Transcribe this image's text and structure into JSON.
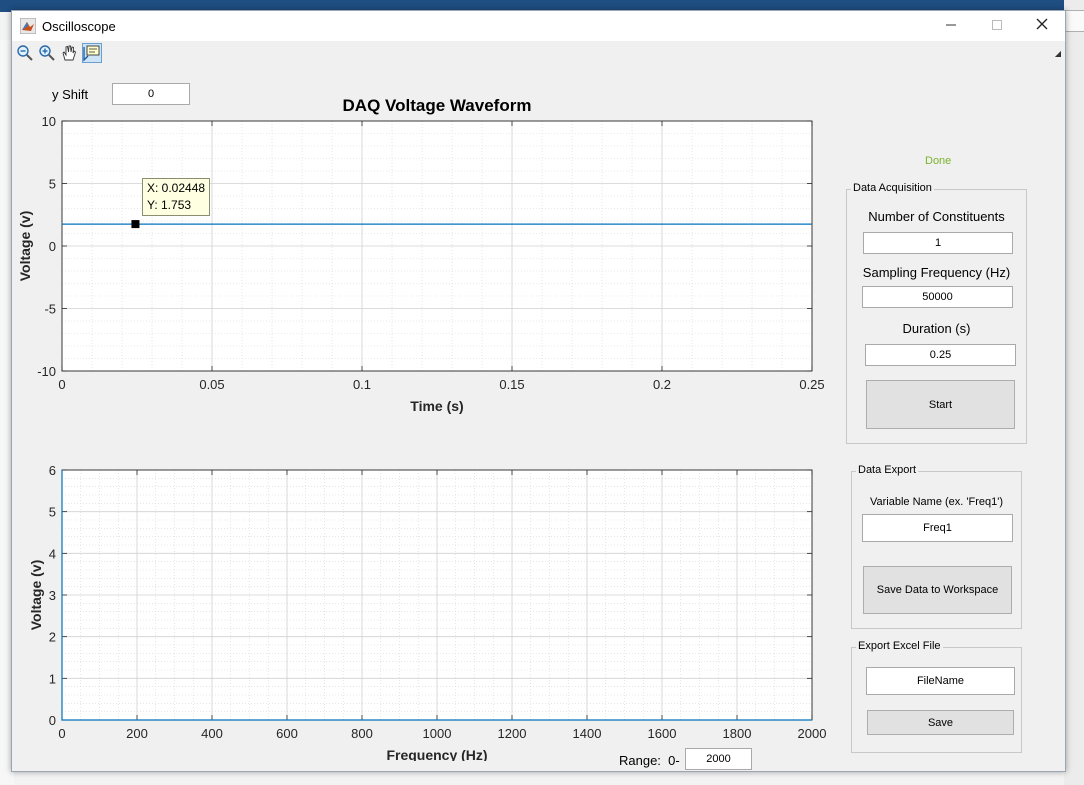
{
  "window": {
    "title": "Oscilloscope"
  },
  "toolbar": {
    "tools": [
      "zoom-out-icon",
      "zoom-in-icon",
      "pan-hand-icon",
      "data-cursor-icon"
    ]
  },
  "y_shift": {
    "label": "y Shift",
    "value": "0"
  },
  "status": {
    "text": "Done",
    "color": "#7ab32e"
  },
  "acquisition": {
    "title": "Data Acquisition",
    "constituents_label": "Number of Constituents",
    "constituents_value": "1",
    "sampling_label": "Sampling Frequency (Hz)",
    "sampling_value": "50000",
    "duration_label": "Duration (s)",
    "duration_value": "0.25",
    "start_label": "Start"
  },
  "export": {
    "title": "Data Export",
    "var_label": "Variable Name (ex. 'Freq1')",
    "var_value": "Freq1",
    "save_ws_label": "Save Data to Workspace"
  },
  "excel": {
    "title": "Export Excel File",
    "filename_value": "FileName",
    "save_label": "Save"
  },
  "range": {
    "label": "Range:  0-",
    "value": "2000"
  },
  "chart_data": [
    {
      "type": "line",
      "title": "DAQ Voltage Waveform",
      "xlabel": "Time (s)",
      "ylabel": "Voltage (v)",
      "xlim": [
        0,
        0.25
      ],
      "ylim": [
        -10,
        10
      ],
      "xticks": [
        0,
        0.05,
        0.1,
        0.15,
        0.2,
        0.25
      ],
      "xtick_labels": [
        "0",
        "0.05",
        "0.1",
        "0.15",
        "0.2",
        "0.25"
      ],
      "yticks": [
        -10,
        -5,
        0,
        5,
        10
      ],
      "ytick_labels": [
        "-10",
        "-5",
        "0",
        "5",
        "10"
      ],
      "grid": true,
      "minor_grid": true,
      "series": [
        {
          "x": [
            0,
            0.25
          ],
          "y": [
            1.753,
            1.753
          ],
          "color": "#0072bd"
        }
      ],
      "datatip": {
        "x": 0.02448,
        "y": 1.753,
        "xtext": "X: 0.02448",
        "ytext": "Y: 1.753"
      }
    },
    {
      "type": "line",
      "title": "",
      "xlabel": "Frequency (Hz)",
      "ylabel": "Voltage (v)",
      "xlim": [
        0,
        2000
      ],
      "ylim": [
        0,
        6
      ],
      "xticks": [
        0,
        200,
        400,
        600,
        800,
        1000,
        1200,
        1400,
        1600,
        1800,
        2000
      ],
      "xtick_labels": [
        "0",
        "200",
        "400",
        "600",
        "800",
        "1000",
        "1200",
        "1400",
        "1600",
        "1800",
        "2000"
      ],
      "yticks": [
        0,
        1,
        2,
        3,
        4,
        5,
        6
      ],
      "ytick_labels": [
        "0",
        "1",
        "2",
        "3",
        "4",
        "5",
        "6"
      ],
      "grid": true,
      "minor_grid": true,
      "series": [
        {
          "x": [
            0,
            0,
            2000
          ],
          "y": [
            6,
            0,
            0
          ],
          "color": "#0072bd"
        }
      ]
    }
  ]
}
